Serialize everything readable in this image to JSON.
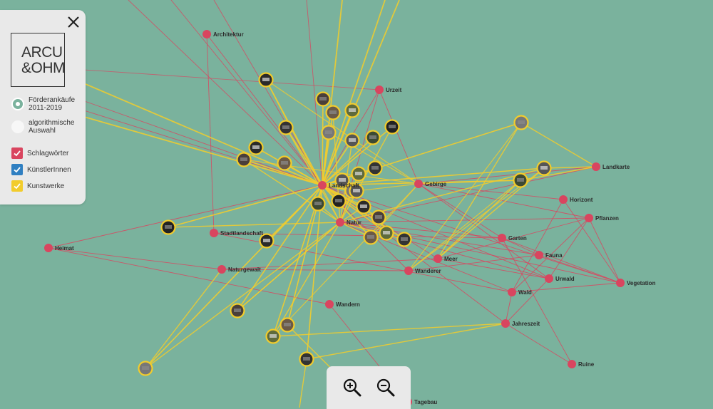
{
  "panel": {
    "logo": {
      "line1": "ARCU",
      "line2": "&OHM"
    },
    "radios": [
      {
        "label": "Förderankäufe 2011-2019",
        "selected": true
      },
      {
        "label": "algorithmische Auswahl",
        "selected": false
      }
    ],
    "filters": [
      {
        "label": "Schlagwörter",
        "color": "#d9455f",
        "checked": true
      },
      {
        "label": "KünstlerInnen",
        "color": "#2f7fc1",
        "checked": true
      },
      {
        "label": "Kunstwerke",
        "color": "#f2cc2c",
        "checked": true
      }
    ]
  },
  "colors": {
    "background": "#7ab29d",
    "keyword": "#d9455f",
    "artwork": "#f2cc2c",
    "panel": "#e9e9e9"
  },
  "icons": {
    "close": "close-icon",
    "zoom_in": "zoom-in-icon",
    "zoom_out": "zoom-out-icon"
  },
  "keywords": [
    "Architektur",
    "Urzeit",
    "Landkarte",
    "Landschaft",
    "Gebirge",
    "Horizont",
    "Pflanzen",
    "Natur",
    "Stadtlandschaft",
    "Garten",
    "Heimat",
    "Fauna",
    "Meer",
    "Naturgewalt",
    "Wanderer",
    "Urwald",
    "Vegetation",
    "Wald",
    "Wandern",
    "Jahreszeit",
    "Ruine",
    "Tagebau"
  ]
}
